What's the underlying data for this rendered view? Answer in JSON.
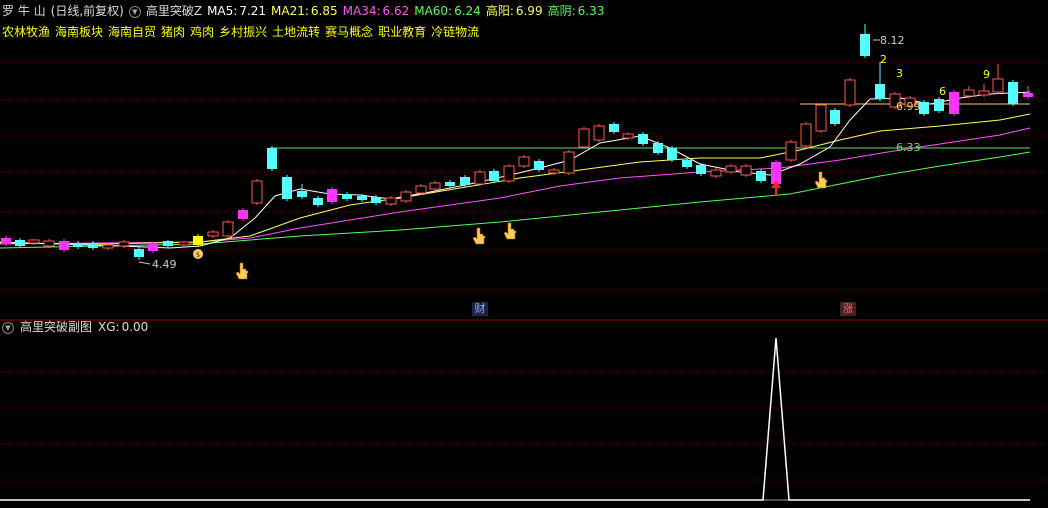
{
  "header": {
    "stock_name": "罗 牛 山",
    "period": "(日线,前复权)",
    "indicator_name": "高里突破Z",
    "ma5_label": "MA5:",
    "ma5_value": "7.21",
    "ma21_label": "MA21:",
    "ma21_value": "6.85",
    "ma34_label": "MA34:",
    "ma34_value": "6.62",
    "ma60_label": "MA60:",
    "ma60_value": "6.24",
    "high_yang_label": "高阳:",
    "high_yang_value": "6.99",
    "high_yin_label": "高阴:",
    "high_yin_value": "6.33"
  },
  "concepts": [
    "农林牧渔",
    "海南板块",
    "海南自贸",
    "猪肉",
    "鸡肉",
    "乡村振兴",
    "土地流转",
    "赛马概念",
    "职业教育",
    "冷链物流"
  ],
  "annotations": {
    "low_price": "4.49",
    "high_price": "8.12",
    "high_yang_level": "6.99",
    "high_yin_level": "6.33",
    "num_2": "2",
    "num_3": "3",
    "num_6": "6",
    "num_9": "9"
  },
  "badges": {
    "cai": "财",
    "zhang": "涨"
  },
  "sub_panel": {
    "title": "高里突破副图",
    "xg_label": "XG:",
    "xg_value": "0.00"
  },
  "colors": {
    "up": "#ff5555",
    "down": "#54ffff",
    "ma5": "#ffffff",
    "ma21": "#ffff55",
    "ma34": "#ff55ff",
    "ma60": "#55ff55",
    "level_yang": "#ffcc66",
    "level_yin": "#66dd66",
    "grid": "#8b0000",
    "label_gold": "#ffff00"
  }
}
